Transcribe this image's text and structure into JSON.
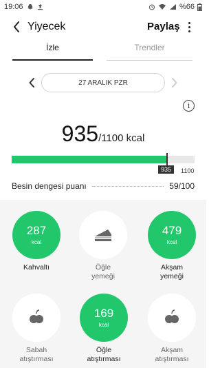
{
  "status_bar": {
    "time": "19:06",
    "battery": "%66"
  },
  "header": {
    "title": "Yiyecek",
    "share_label": "Paylaş"
  },
  "tabs": [
    {
      "label": "İzle",
      "active": true
    },
    {
      "label": "Trendler",
      "active": false
    }
  ],
  "date": {
    "label": "27 ARALIK PZR"
  },
  "calories": {
    "consumed": "935",
    "target_text": "/1100 kcal",
    "progress_fraction": 0.85,
    "badge": "935",
    "max": "1100"
  },
  "balance": {
    "label": "Besin dengesi puanı",
    "value": "59/100"
  },
  "meals": [
    {
      "kcal": "287",
      "unit": "kcal",
      "label": "Kahvaltı",
      "filled": true,
      "icon": ""
    },
    {
      "kcal": "",
      "unit": "",
      "label": "Öğle\nyemeği",
      "filled": false,
      "icon": "sandwich-icon"
    },
    {
      "kcal": "479",
      "unit": "kcal",
      "label": "Akşam\nyemeği",
      "filled": true,
      "icon": ""
    },
    {
      "kcal": "",
      "unit": "",
      "label": "Sabah\natıştırması",
      "filled": false,
      "icon": "apple-icon"
    },
    {
      "kcal": "169",
      "unit": "kcal",
      "label": "Öğle\natıştırması",
      "filled": true,
      "icon": ""
    },
    {
      "kcal": "",
      "unit": "",
      "label": "Akşam\natıştırması",
      "filled": false,
      "icon": "apple-icon"
    }
  ],
  "colors": {
    "accent": "#22c76b",
    "track": "#e8e8e8",
    "meals_bg": "#f5f5f5"
  }
}
